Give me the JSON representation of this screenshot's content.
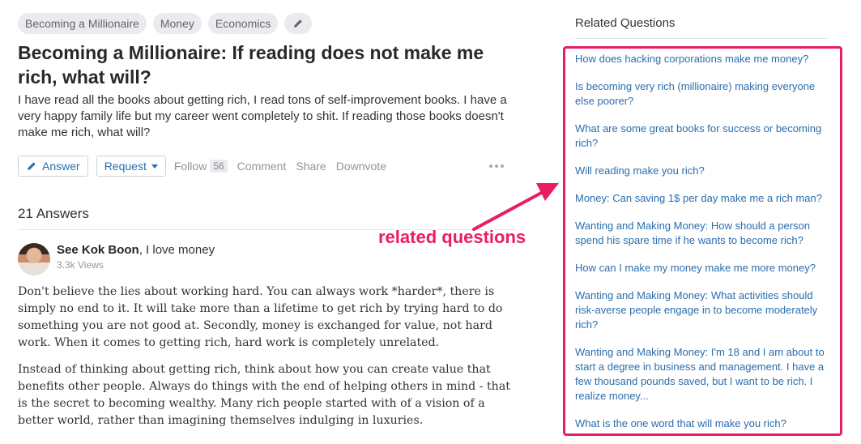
{
  "topics": [
    "Becoming a Millionaire",
    "Money",
    "Economics"
  ],
  "question": {
    "title": "Becoming a Millionaire: If reading does not make me rich, what will?",
    "details": "I have read all the books about getting rich, I read tons of self-improvement books. I have a very happy family life but my career went completely to shit. If reading those books doesn't make me rich, what will?"
  },
  "actions": {
    "answer": "Answer",
    "request": "Request",
    "follow": "Follow",
    "follow_count": "56",
    "comment": "Comment",
    "share": "Share",
    "downvote": "Downvote"
  },
  "answers_count": "21 Answers",
  "answer": {
    "author_name": "See Kok Boon",
    "author_credential": ", I love money",
    "views": "3.3k Views",
    "paragraphs": [
      "Don't believe the lies about working hard. You can always work *harder*, there is simply no end to it. It will take more than a lifetime to get rich by trying hard to do something you are not good at. Secondly, money is exchanged for value, not hard work. When it comes to getting rich, hard work is completely unrelated.",
      "Instead of thinking about getting rich, think about how you can create value that benefits other people. Always do things with the end of helping others in mind - that is the secret to becoming wealthy. Many rich people started with of a vision of a better world, rather than imagining themselves indulging in luxuries."
    ]
  },
  "related": {
    "header": "Related Questions",
    "items": [
      "How does hacking corporations make me money?",
      "Is becoming very rich (millionaire) making everyone else poorer?",
      "What are some great books for success or becoming rich?",
      "Will reading make you rich?",
      "Money: Can saving 1$ per day make me a rich man?",
      "Wanting and Making Money: How should a person spend his spare time if he wants to become rich?",
      "How can I make my money make me more money?",
      "Wanting and Making Money: What activities should risk-averse people engage in to become moderately rich?",
      "Wanting and Making Money: I'm 18 and I am about to start a degree in business and management. I have a few thousand pounds saved, but I want to be rich. I realize money...",
      "What is the one word that will make you rich?"
    ]
  },
  "annotation": {
    "label": "related questions",
    "color": "#ea1d61"
  },
  "colors": {
    "link": "#2b6dad",
    "muted": "#949494",
    "highlight": "#ea1d61"
  }
}
